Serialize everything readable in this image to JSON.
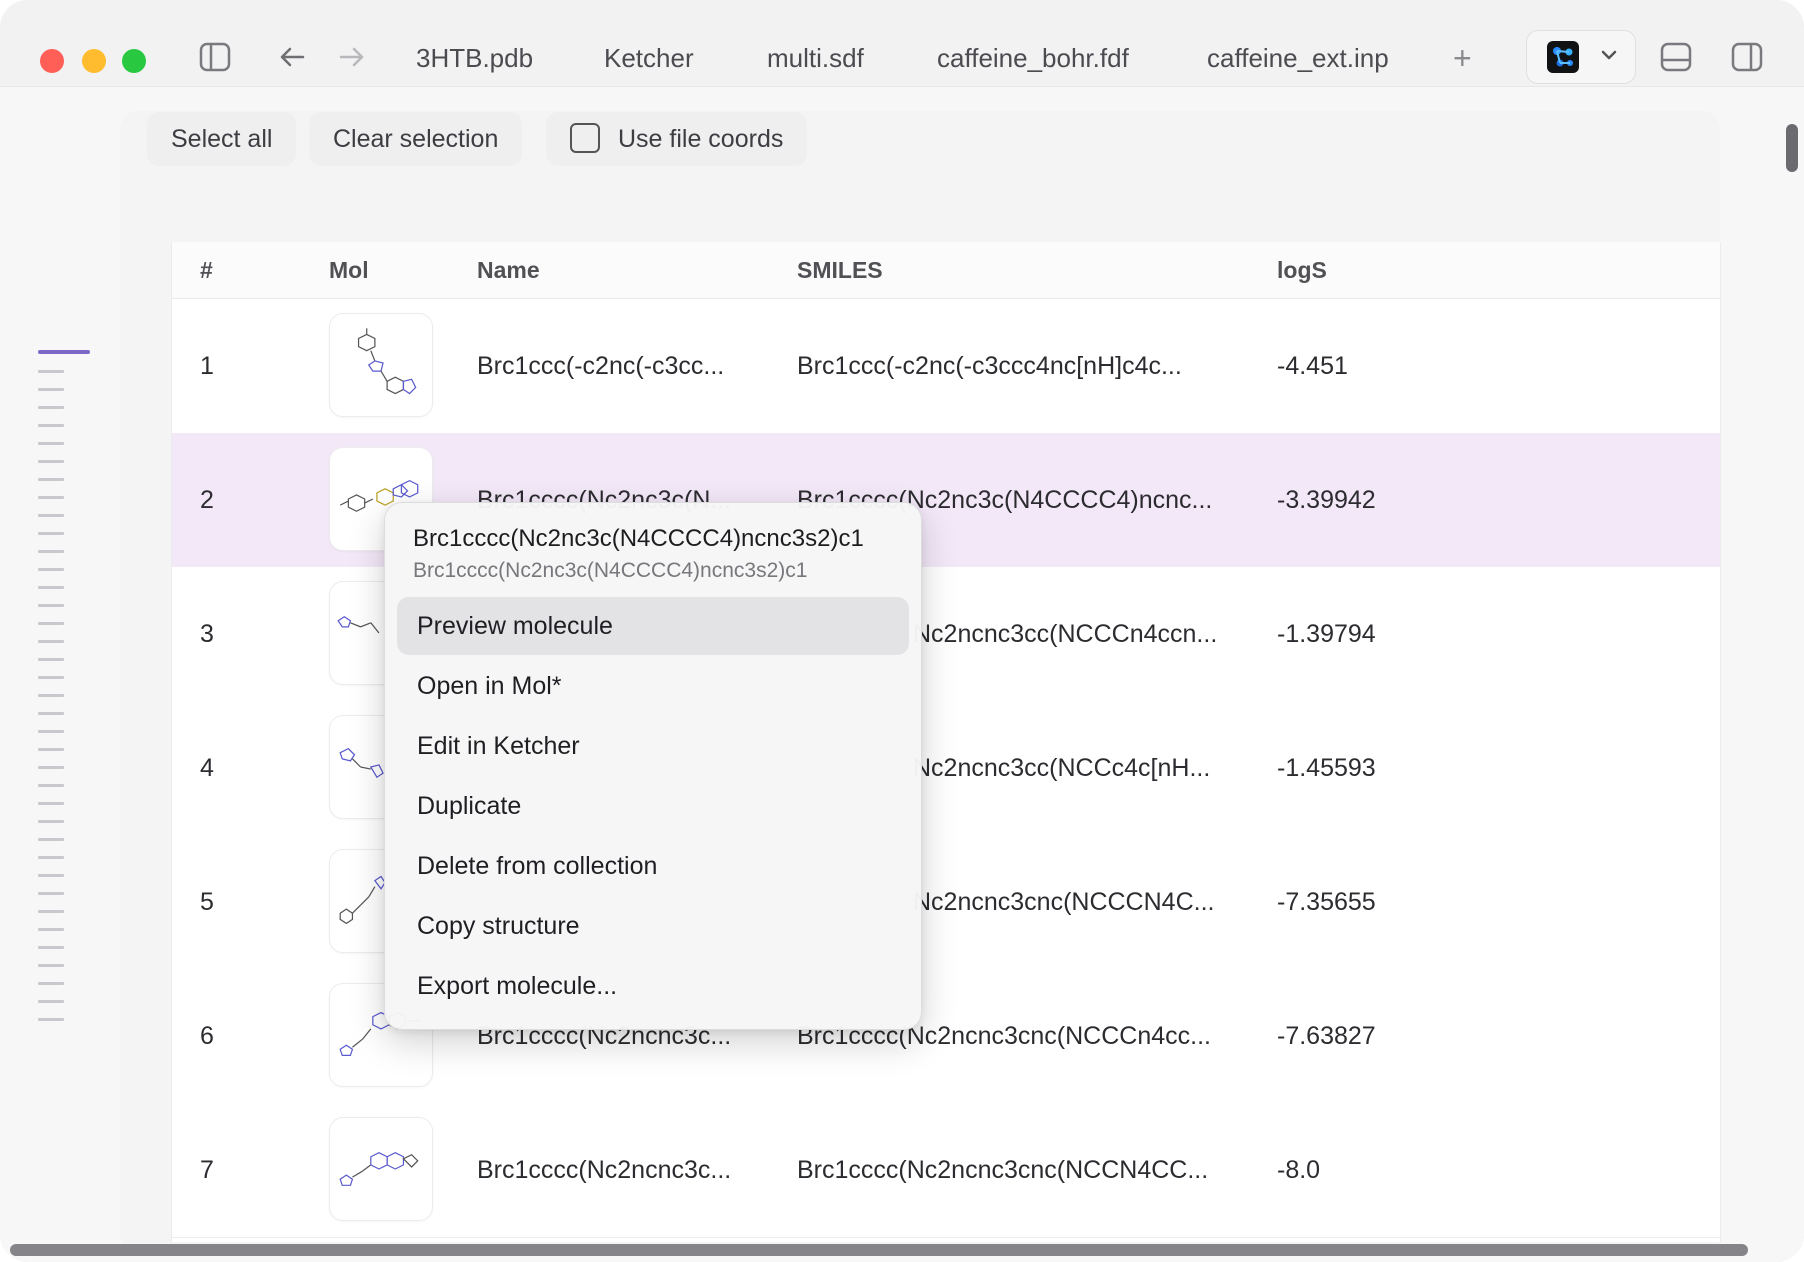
{
  "window": {
    "tabs": [
      "3HTB.pdb",
      "Ketcher",
      "multi.sdf",
      "caffeine_bohr.fdf",
      "caffeine_ext.inp"
    ],
    "icons": {
      "sidebar_toggle": "sidebar-left-icon",
      "back": "arrow-left-icon",
      "forward": "arrow-right-icon",
      "new_tab": "plus-icon",
      "app_logo": "molecule-logo-icon",
      "app_chevron": "chevron-down-icon",
      "bottom_panel": "panel-bottom-icon",
      "right_panel": "sidebar-right-icon"
    },
    "add_tab_glyph": "+"
  },
  "toolbar": {
    "select_all": "Select all",
    "clear_selection": "Clear selection",
    "use_file_coords": "Use file coords"
  },
  "table": {
    "columns": [
      "#",
      "Mol",
      "Name",
      "SMILES",
      "logS"
    ],
    "rows": [
      {
        "index": "1",
        "name": "Brc1ccc(-c2nc(-c3cc...",
        "smiles": "Brc1ccc(-c2nc(-c3ccc4nc[nH]c4c...",
        "logS": "-4.451"
      },
      {
        "index": "2",
        "name": "Brc1cccc(Nc2nc3c(N...",
        "smiles": "Brc1cccc(Nc2nc3c(N4CCCC4)ncnc...",
        "logS": "-3.39942"
      },
      {
        "index": "3",
        "name": "",
        "smiles": "Nc2ncnc3cc(NCCCn4ccn...",
        "logS": "-1.39794"
      },
      {
        "index": "4",
        "name": "",
        "smiles": "Nc2ncnc3cc(NCCc4c[nH...",
        "logS": "-1.45593"
      },
      {
        "index": "5",
        "name": "",
        "smiles": "Nc2ncnc3cnc(NCCCN4C...",
        "logS": "-7.35655"
      },
      {
        "index": "6",
        "name": "Brc1cccc(Nc2ncnc3c...",
        "smiles": "Brc1cccc(Nc2ncnc3cnc(NCCCn4cc...",
        "logS": "-7.63827"
      },
      {
        "index": "7",
        "name": "Brc1cccc(Nc2ncnc3c...",
        "smiles": "Brc1cccc(Nc2ncnc3cnc(NCCN4CC...",
        "logS": "-8.0"
      }
    ],
    "selected_row": 2
  },
  "context_menu": {
    "title": "Brc1cccc(Nc2nc3c(N4CCCC4)ncnc3s2)c1",
    "subtitle": "Brc1cccc(Nc2nc3c(N4CCCC4)ncnc3s2)c1",
    "items": [
      "Preview molecule",
      "Open in Mol*",
      "Edit in Ketcher",
      "Duplicate",
      "Delete from collection",
      "Copy structure",
      "Export molecule..."
    ],
    "hovered_item": "Preview molecule"
  },
  "colors": {
    "selected_row": "#f3e8f8",
    "accent": "#7b68c6",
    "traffic_red": "#ff5f57",
    "traffic_yellow": "#febc2e",
    "traffic_green": "#28c840"
  }
}
